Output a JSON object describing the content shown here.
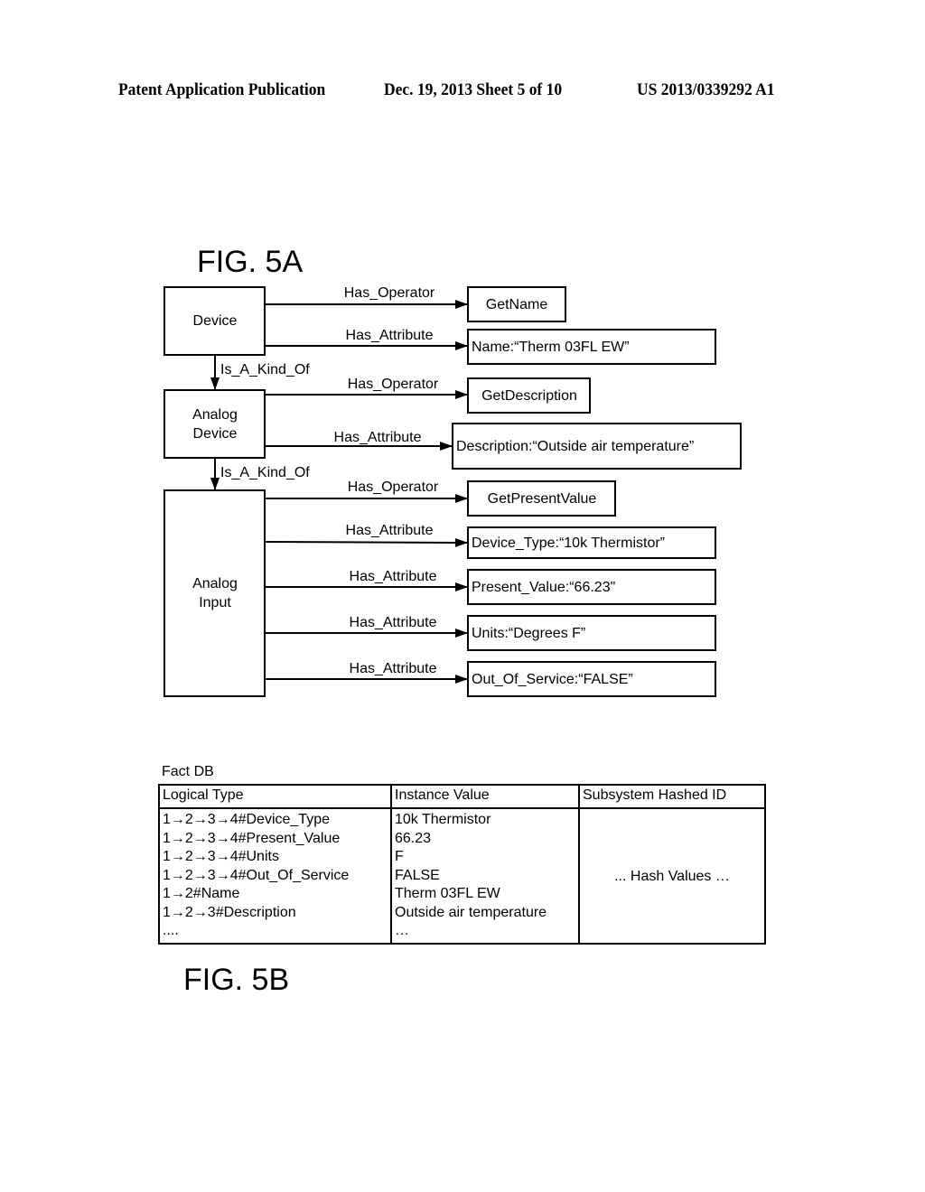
{
  "header": {
    "publication": "Patent Application Publication",
    "date_sheet": "Dec. 19, 2013   Sheet 5 of 10",
    "number": "US 2013/0339292 A1"
  },
  "fig5a": {
    "title": "FIG. 5A",
    "classes": [
      {
        "id": "device",
        "lines": [
          "Device"
        ]
      },
      {
        "id": "analog-device",
        "lines": [
          "Analog",
          "Device"
        ]
      },
      {
        "id": "analog-input",
        "lines": [
          "Analog",
          "Input"
        ]
      }
    ],
    "inheritance_label": "Is_A_Kind_Of",
    "edges": [
      {
        "from": "device",
        "relation": "Has_Operator",
        "target": "GetName"
      },
      {
        "from": "device",
        "relation": "Has_Attribute",
        "target": "Name:“Therm 03FL EW”"
      },
      {
        "from": "analog-device",
        "relation": "Has_Operator",
        "target": "GetDescription"
      },
      {
        "from": "analog-device",
        "relation": "Has_Attribute",
        "target": "Description:“Outside air temperature”"
      },
      {
        "from": "analog-input",
        "relation": "Has_Operator",
        "target": "GetPresentValue"
      },
      {
        "from": "analog-input",
        "relation": "Has_Attribute",
        "target": "Device_Type:“10k Thermistor”"
      },
      {
        "from": "analog-input",
        "relation": "Has_Attribute",
        "target": "Present_Value:“66.23\""
      },
      {
        "from": "analog-input",
        "relation": "Has_Attribute",
        "target": "Units:“Degrees F”"
      },
      {
        "from": "analog-input",
        "relation": "Has_Attribute",
        "target": "Out_Of_Service:“FALSE”"
      }
    ]
  },
  "fig5b": {
    "title": "FIG. 5B",
    "table_title": "Fact DB",
    "columns": [
      "Logical Type",
      "Instance Value",
      "Subsystem Hashed ID"
    ],
    "logical_types": [
      "1→2→3→4#Device_Type",
      "1→2→3→4#Present_Value",
      "1→2→3→4#Units",
      "1→2→3→4#Out_Of_Service",
      "1→2#Name",
      "1→2→3#Description",
      "...."
    ],
    "instance_values": [
      "10k Thermistor",
      "66.23",
      "F",
      "FALSE",
      "Therm 03FL EW",
      "Outside air temperature",
      "…"
    ],
    "hash_values": "... Hash Values …"
  }
}
